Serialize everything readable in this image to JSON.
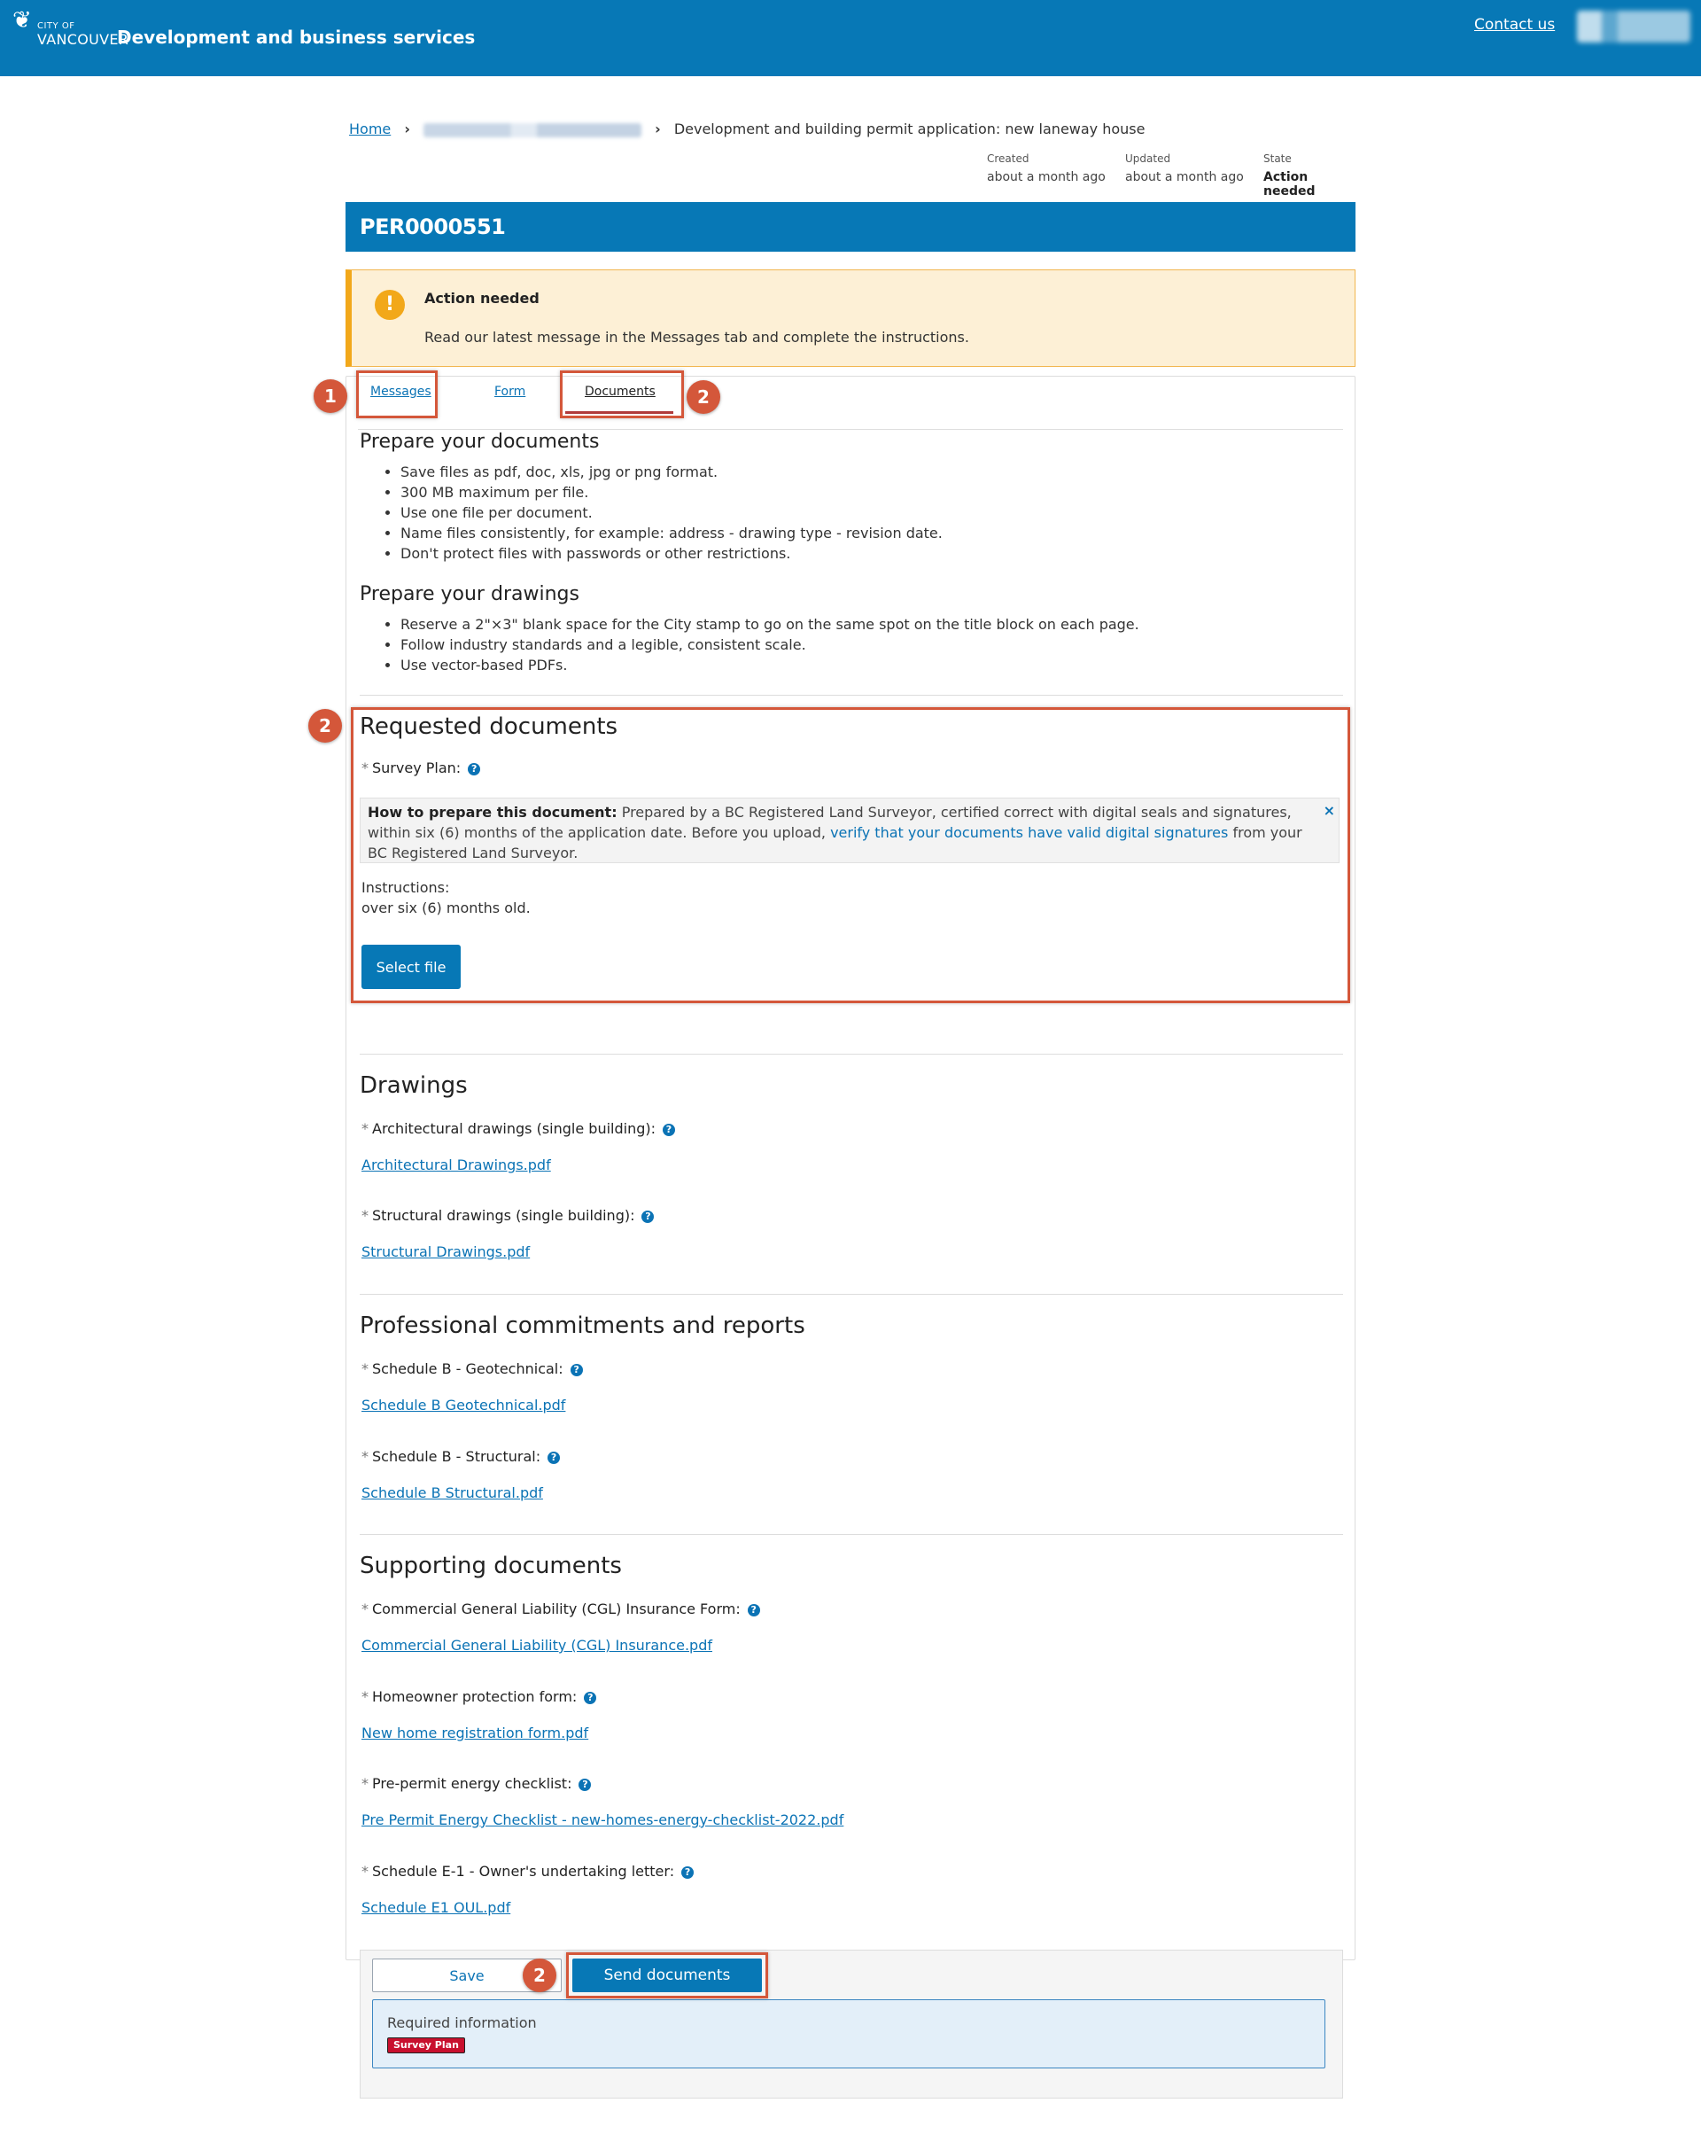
{
  "header": {
    "logo_city": "CITY OF",
    "logo_name": "VANCOUVER",
    "site_title": "Development and business services",
    "contact_label": "Contact us"
  },
  "breadcrumb": {
    "home": "Home",
    "current": "Development and building permit application: new laneway house"
  },
  "meta": {
    "created_label": "Created",
    "created_value": "about a month ago",
    "updated_label": "Updated",
    "updated_value": "about a month ago",
    "state_label": "State",
    "state_value": "Action needed"
  },
  "permit_id": "PER0000551",
  "alert": {
    "title": "Action needed",
    "message": "Read our latest message in the Messages tab and complete the instructions.",
    "icon": "exclamation-icon"
  },
  "tabs": [
    {
      "label": "Messages",
      "active": false
    },
    {
      "label": "Form",
      "active": false
    },
    {
      "label": "Documents",
      "active": true
    }
  ],
  "annotations": [
    "1",
    "2",
    "2",
    "2"
  ],
  "prepare_documents": {
    "heading": "Prepare your documents",
    "items": [
      "Save files as pdf, doc, xls, jpg or png format.",
      "300 MB maximum per file.",
      "Use one file per document.",
      "Name files consistently, for example: address - drawing type - revision date.",
      "Don't protect files with passwords or other restrictions."
    ]
  },
  "prepare_drawings": {
    "heading": "Prepare your drawings",
    "items": [
      "Reserve a 2\"×3\" blank space for the City stamp to go on the same spot on the title block on each page.",
      "Follow industry standards and a legible, consistent scale.",
      "Use vector-based PDFs."
    ]
  },
  "requested": {
    "heading": "Requested documents",
    "field_label": "Survey Plan:",
    "howto_label": "How to prepare this document:",
    "howto_text": "Prepared by a BC Registered Land Surveyor, certified correct with digital seals and signatures, within six (6) months of the application date. Before you upload,",
    "howto_link": "verify that your documents have valid digital signatures",
    "howto_tail": "from your BC Registered Land Surveyor.",
    "close_glyph": "×",
    "instructions_label": "Instructions:",
    "instructions_text": "over six (6) months old.",
    "select_label": "Select file"
  },
  "drawings": {
    "heading": "Drawings",
    "fields": [
      {
        "label": "Architectural drawings (single building):",
        "file": "Architectural Drawings.pdf"
      },
      {
        "label": "Structural drawings (single building):",
        "file": "Structural Drawings.pdf"
      }
    ]
  },
  "professional": {
    "heading": "Professional commitments and reports",
    "fields": [
      {
        "label": "Schedule B - Geotechnical:",
        "file": "Schedule B Geotechnical.pdf"
      },
      {
        "label": "Schedule B - Structural:",
        "file": "Schedule B Structural.pdf"
      }
    ]
  },
  "supporting": {
    "heading": "Supporting documents",
    "fields": [
      {
        "label": "Commercial General Liability (CGL) Insurance Form:",
        "file": "Commercial General Liability (CGL) Insurance.pdf"
      },
      {
        "label": "Homeowner protection form:",
        "file": "New home registration form.pdf"
      },
      {
        "label": "Pre-permit energy checklist:",
        "file": "Pre Permit Energy Checklist - new-homes-energy-checklist-2022.pdf"
      },
      {
        "label": "Schedule E-1 - Owner's undertaking letter:",
        "file": "Schedule E1 OUL.pdf"
      }
    ]
  },
  "required_marker": "*",
  "help_glyph": "?",
  "footer": {
    "save_label": "Save",
    "send_label": "Send documents",
    "required_title": "Required information",
    "required_tag": "Survey Plan"
  },
  "colors": {
    "header_blue": "#0778b6",
    "annotation_orange": "#d4573a",
    "alert_amber": "#f2a81a",
    "required_red": "#c8102e"
  }
}
